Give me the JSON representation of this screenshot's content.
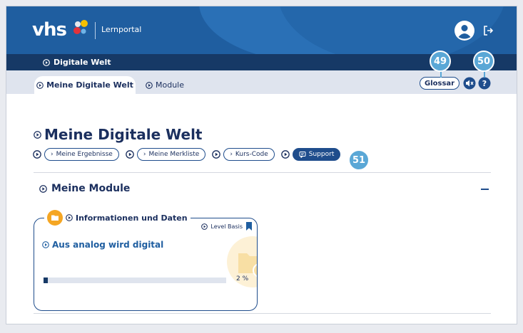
{
  "header": {
    "logo": "vhs",
    "portal_label": "Lernportal"
  },
  "breadcrumb": {
    "current": "Digitale Welt"
  },
  "tabs": [
    {
      "label": "Meine Digitale Welt",
      "active": true
    },
    {
      "label": "Module",
      "active": false
    }
  ],
  "toolbar": {
    "glossar_label": "Glossar"
  },
  "callouts": {
    "glossar": "49",
    "help": "50",
    "support": "51"
  },
  "page": {
    "title": "Meine Digitale Welt"
  },
  "chips": [
    {
      "label": "Meine Ergebnisse",
      "icon": "chevron-right-icon"
    },
    {
      "label": "Meine Merkliste",
      "icon": "chevron-right-icon"
    },
    {
      "label": "Kurs-Code",
      "icon": "chevron-right-icon"
    },
    {
      "label": "Support",
      "icon": "chat-icon"
    }
  ],
  "modules": {
    "title": "Meine Module"
  },
  "card": {
    "category": "Informationen und Daten",
    "level": "Level Basis",
    "title": "Aus analog wird digital",
    "progress_label": "2 %",
    "progress": 0.02
  },
  "colors": {
    "brand_blue": "#1f5ea0",
    "navy": "#163966",
    "callout": "#5aa7d6",
    "accent_orange": "#f5a623"
  }
}
